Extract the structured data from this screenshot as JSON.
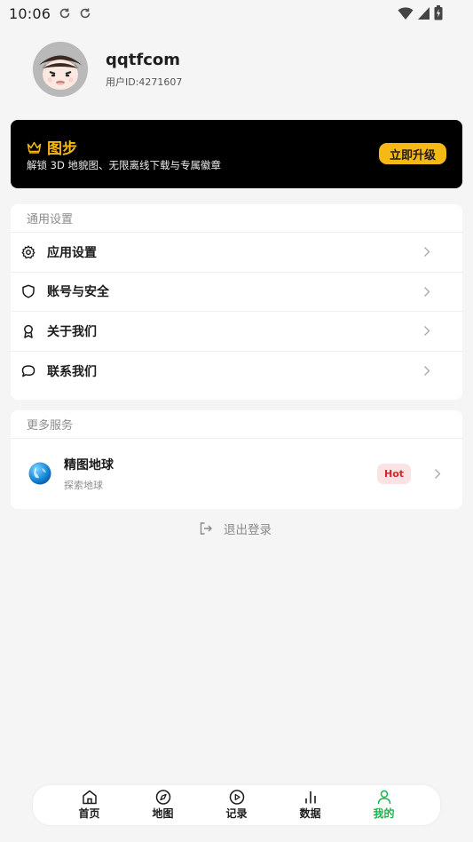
{
  "status_bar": {
    "time": "10:06"
  },
  "profile": {
    "username": "qqtfcom",
    "user_id": "用户ID:4271607"
  },
  "vip": {
    "title": "图步",
    "description": "解锁 3D 地貌图、无限离线下载与专属徽章",
    "upgrade_label": "立即升级",
    "accent_color": "#f5b915"
  },
  "general_settings": {
    "header": "通用设置",
    "items": [
      {
        "label": "应用设置",
        "icon": "gear-icon"
      },
      {
        "label": "账号与安全",
        "icon": "shield-icon"
      },
      {
        "label": "关于我们",
        "icon": "award-icon"
      },
      {
        "label": "联系我们",
        "icon": "chat-bubble-icon"
      }
    ]
  },
  "more_services": {
    "header": "更多服务",
    "items": [
      {
        "title": "精图地球",
        "subtitle": "探索地球",
        "badge": "Hot",
        "icon": "globe-icon"
      }
    ]
  },
  "logout": {
    "label": "退出登录"
  },
  "bottom_nav": {
    "active_color": "#1bb34c",
    "items": [
      {
        "label": "首页",
        "icon": "home-icon"
      },
      {
        "label": "地图",
        "icon": "compass-icon"
      },
      {
        "label": "记录",
        "icon": "play-circle-icon"
      },
      {
        "label": "数据",
        "icon": "bar-chart-icon"
      },
      {
        "label": "我的",
        "icon": "person-icon",
        "active": true
      }
    ]
  }
}
